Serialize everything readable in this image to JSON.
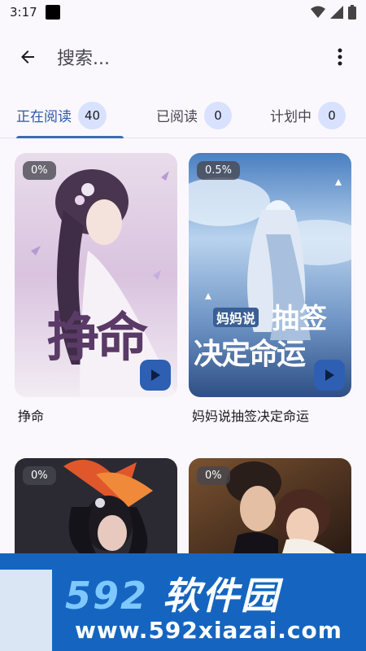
{
  "status_bar": {
    "time": "3:17",
    "icons": [
      "notification-icon",
      "wifi-icon",
      "signal-icon",
      "battery-icon"
    ]
  },
  "app_bar": {
    "back_icon": "arrow-back-icon",
    "search_text": "搜索...",
    "more_icon": "more-vert-icon"
  },
  "tabs": [
    {
      "label": "正在阅读",
      "count": "40",
      "active": true
    },
    {
      "label": "已阅读",
      "count": "0",
      "active": false
    },
    {
      "label": "计划中",
      "count": "0",
      "active": false
    }
  ],
  "books": [
    {
      "title": "挣命",
      "progress": "0%",
      "cover_text": "挣命"
    },
    {
      "title": "妈妈说抽签决定命运",
      "progress": "0.5%",
      "cover_text_small": "妈妈说",
      "cover_text_line1": "抽签",
      "cover_text_line2": "决定命运"
    },
    {
      "title": "",
      "progress": "0%"
    },
    {
      "title": "",
      "progress": "0%"
    }
  ],
  "watermark": {
    "brand_num": "592",
    "brand_text": "软件园",
    "url": "www.592xiazai.com"
  },
  "colors": {
    "accent": "#2b5aa8",
    "badge_bg": "#d8e2ff",
    "play_button": "#2e5fb3",
    "watermark_bg": "#1565c0"
  }
}
